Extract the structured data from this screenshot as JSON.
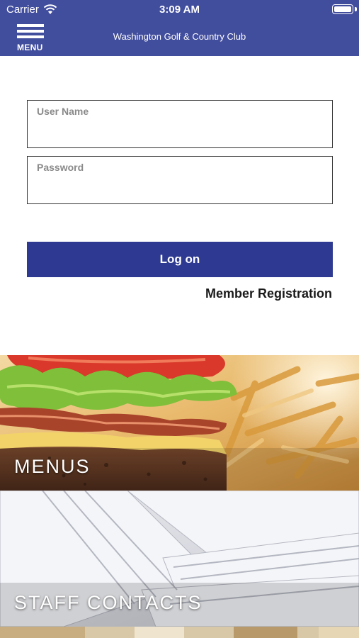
{
  "status_bar": {
    "carrier": "Carrier",
    "time": "3:09 AM"
  },
  "header": {
    "menu_label": "MENU",
    "title": "Washington Golf & Country Club",
    "color": "#414d9d"
  },
  "login": {
    "username_label": "User Name",
    "username_value": "",
    "password_label": "Password",
    "password_value": "",
    "logon_label": "Log on",
    "logon_color": "#2e3a92",
    "member_registration": "Member Registration"
  },
  "tiles": [
    {
      "caption": "MENUS",
      "image": "burger-fries-photo"
    },
    {
      "caption": "STAFF CONTACTS",
      "image": "envelopes-photo"
    },
    {
      "caption": "",
      "image": "partial-photo"
    }
  ],
  "icons": {
    "wifi": "wifi-icon",
    "battery": "battery-icon",
    "menu": "hamburger-icon"
  }
}
